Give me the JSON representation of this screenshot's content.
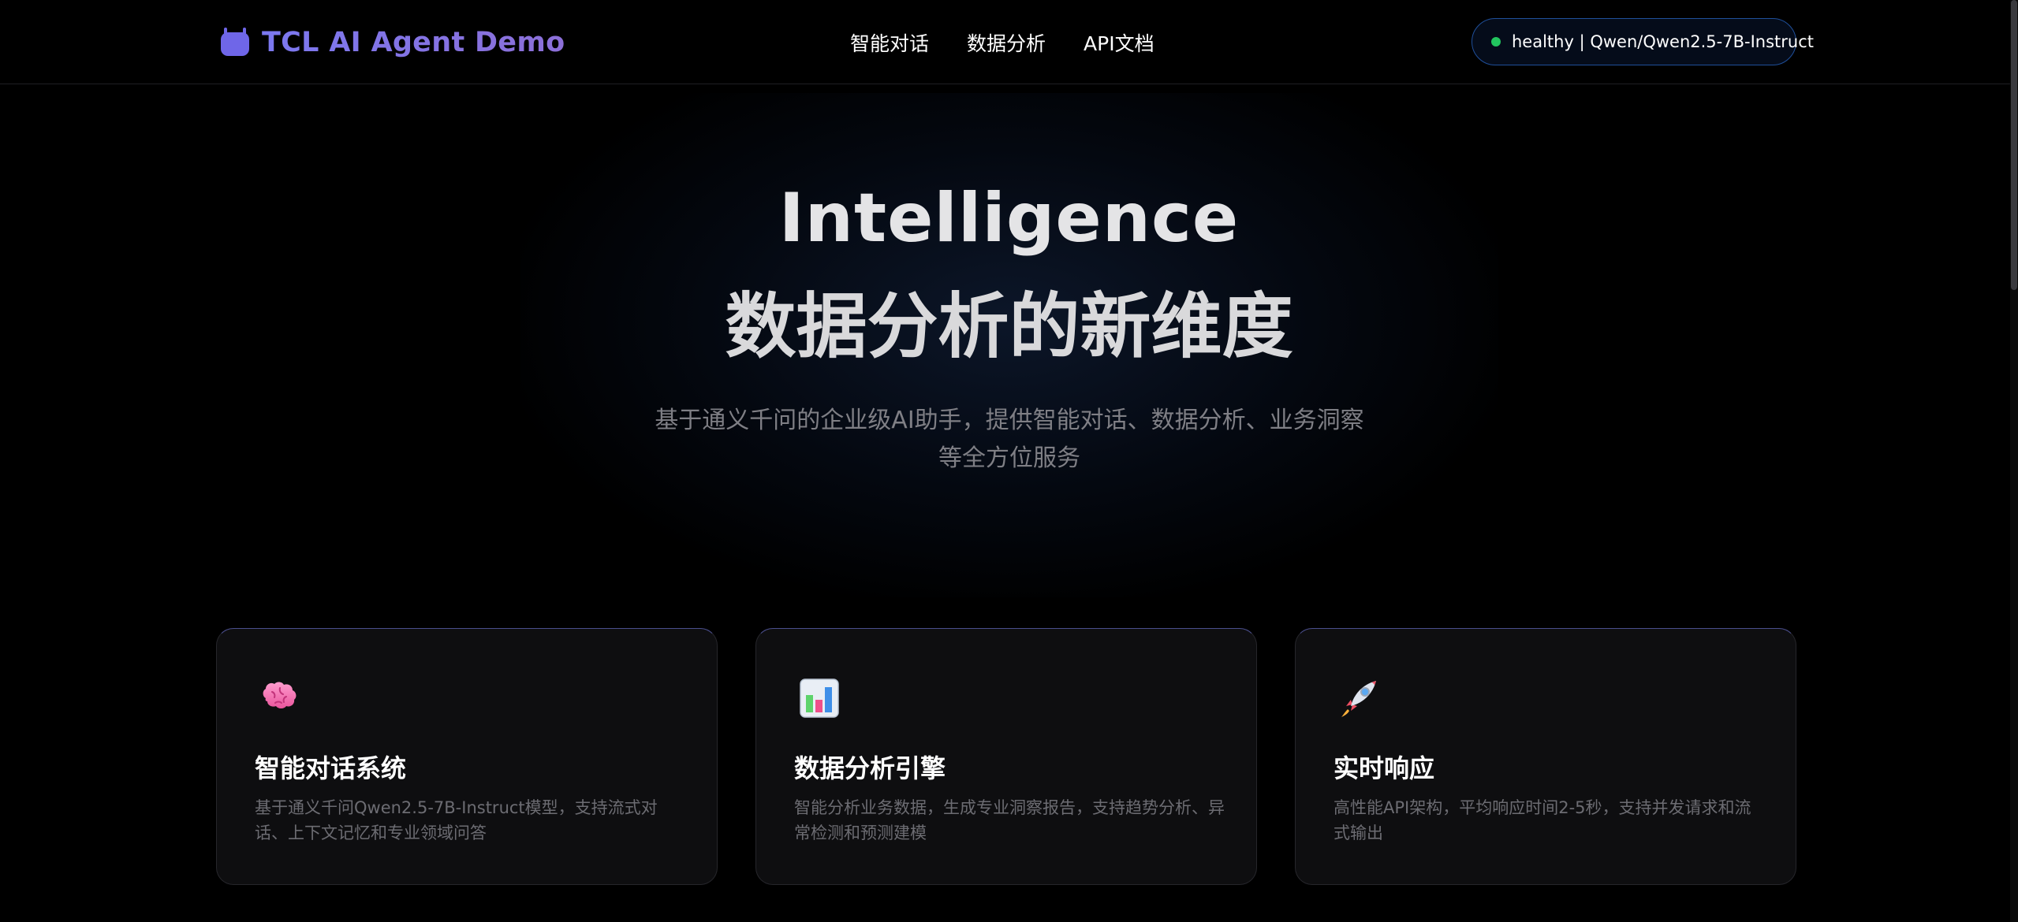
{
  "header": {
    "brand": "TCL AI Agent Demo",
    "nav": [
      {
        "label": "智能对话"
      },
      {
        "label": "数据分析"
      },
      {
        "label": "API文档"
      }
    ],
    "status": "healthy | Qwen/Qwen2.5-7B-Instruct",
    "status_color": "#22c55e"
  },
  "hero": {
    "title_en": "Intelligence",
    "title_zh": "数据分析的新维度",
    "subtitle": "基于通义千问的企业级AI助手，提供智能对话、数据分析、业务洞察等全方位服务"
  },
  "features": [
    {
      "icon": "brain-icon",
      "title": "智能对话系统",
      "desc": "基于通义千问Qwen2.5-7B-Instruct模型，支持流式对话、上下文记忆和专业领域问答"
    },
    {
      "icon": "bar-chart-icon",
      "title": "数据分析引擎",
      "desc": "智能分析业务数据，生成专业洞察报告，支持趋势分析、异常检测和预测建模"
    },
    {
      "icon": "rocket-icon",
      "title": "实时响应",
      "desc": "高性能API架构，平均响应时间2-5秒，支持并发请求和流式输出"
    }
  ],
  "colors": {
    "accent": "#6f66e8",
    "background": "#000000",
    "card_bg": "#0e0e10"
  }
}
